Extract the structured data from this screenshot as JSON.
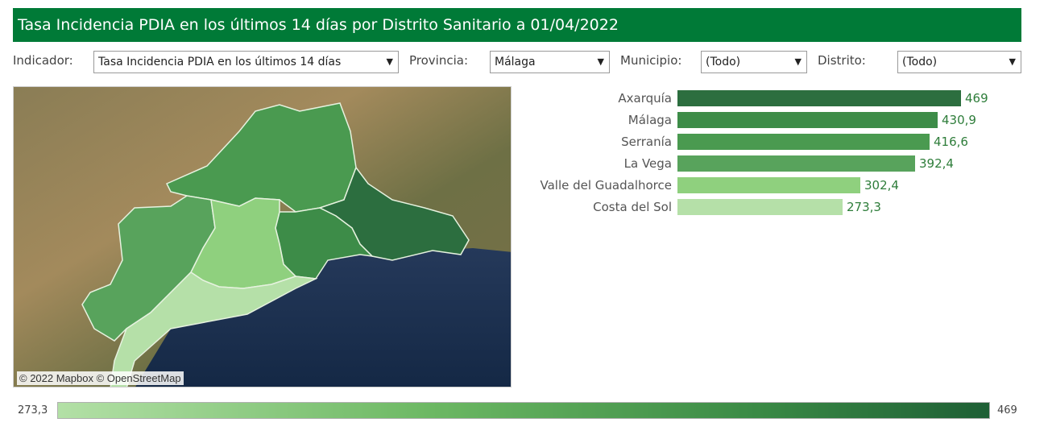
{
  "header": {
    "title": "Tasa Incidencia PDIA en los últimos 14 días por Distrito Sanitario a 01/04/2022"
  },
  "filters": {
    "indicador": {
      "label": "Indicador:",
      "value": "Tasa Incidencia PDIA en los últimos 14 días"
    },
    "provincia": {
      "label": "Provincia:",
      "value": "Málaga"
    },
    "municipio": {
      "label": "Municipio:",
      "value": "(Todo)"
    },
    "distrito": {
      "label": "Distrito:",
      "value": "(Todo)"
    },
    "arrow_icon": "caret-down-icon"
  },
  "map": {
    "attribution": "© 2022 Mapbox  © OpenStreetMap",
    "region_colors": {
      "axarquia": "#2c6e3f",
      "malaga": "#3d8c48",
      "serrania": "#4a9a50",
      "la_vega": "#58a35c",
      "valle_del_guadalhorce": "#8fd07e",
      "costa_del_sol": "#b5e0a8"
    }
  },
  "chart_data": {
    "type": "bar",
    "orientation": "horizontal",
    "categories": [
      "Axarquía",
      "Málaga",
      "Serranía",
      "La Vega",
      "Valle del Guadalhorce",
      "Costa del Sol"
    ],
    "values": [
      469,
      430.9,
      416.6,
      392.4,
      302.4,
      273.3
    ],
    "value_labels": [
      "469",
      "430,9",
      "416,6",
      "392,4",
      "302,4",
      "273,3"
    ],
    "colors": [
      "#2c6e3f",
      "#3d8c48",
      "#4a9a50",
      "#58a35c",
      "#8fd07e",
      "#b5e0a8"
    ],
    "xlim": [
      0,
      469
    ]
  },
  "legend": {
    "min_label": "273,3",
    "max_label": "469",
    "color_low": "#b3e0a6",
    "color_high": "#1e5f35"
  }
}
